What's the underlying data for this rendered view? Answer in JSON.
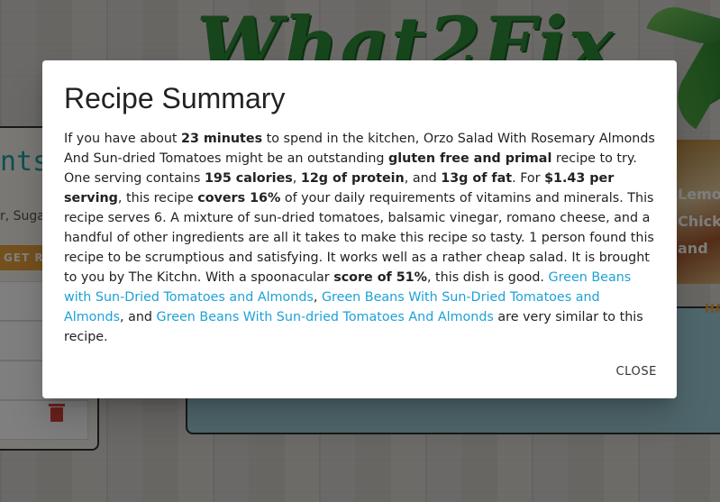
{
  "background": {
    "logo_text": "What2Fix",
    "left_panel": {
      "title": "nts",
      "input_text": "r, Suga",
      "button_label": "GET RE"
    },
    "right_card": {
      "photo_lines": [
        "Lemo",
        "Chick",
        "and"
      ],
      "side_label": "HA"
    }
  },
  "dialog": {
    "title": "Recipe Summary",
    "summary": {
      "t1": "If you have about ",
      "b1": "23 minutes",
      "t2": " to spend in the kitchen, Orzo Salad With Rosemary Almonds And Sun-dried Tomatoes might be an outstanding ",
      "b2": "gluten free and primal",
      "t3": " recipe to try. One serving contains ",
      "b3": "195 calories",
      "t4": ", ",
      "b4": "12g of protein",
      "t5": ", and ",
      "b5": "13g of fat",
      "t6": ". For ",
      "b6": "$1.43 per serving",
      "t7": ", this recipe ",
      "b7": "covers 16%",
      "t8": " of your daily requirements of vitamins and minerals. This recipe serves 6. A mixture of sun-dried tomatoes, balsamic vinegar, romano cheese, and a handful of other ingredients are all it takes to make this recipe so tasty. 1 person found this recipe to be scrumptious and satisfying. It works well as a rather cheap salad. It is brought to you by The Kitchn. With a spoonacular ",
      "b8": "score of 51%",
      "t9": ", this dish is good. ",
      "link1": "Green Beans with Sun-Dried Tomatoes and Almonds",
      "t10": ", ",
      "link2": "Green Beans With Sun-Dried Tomatoes and Almonds",
      "t11": ", and ",
      "link3": "Green Beans With Sun-dried Tomatoes And Almonds",
      "t12": " are very similar to this recipe."
    },
    "close_label": "CLOSE"
  },
  "colors": {
    "link": "#1ea1d6",
    "logo": "#2f8a39",
    "accent_orange": "#e8a03a",
    "teal_card": "#9fcfd8"
  }
}
